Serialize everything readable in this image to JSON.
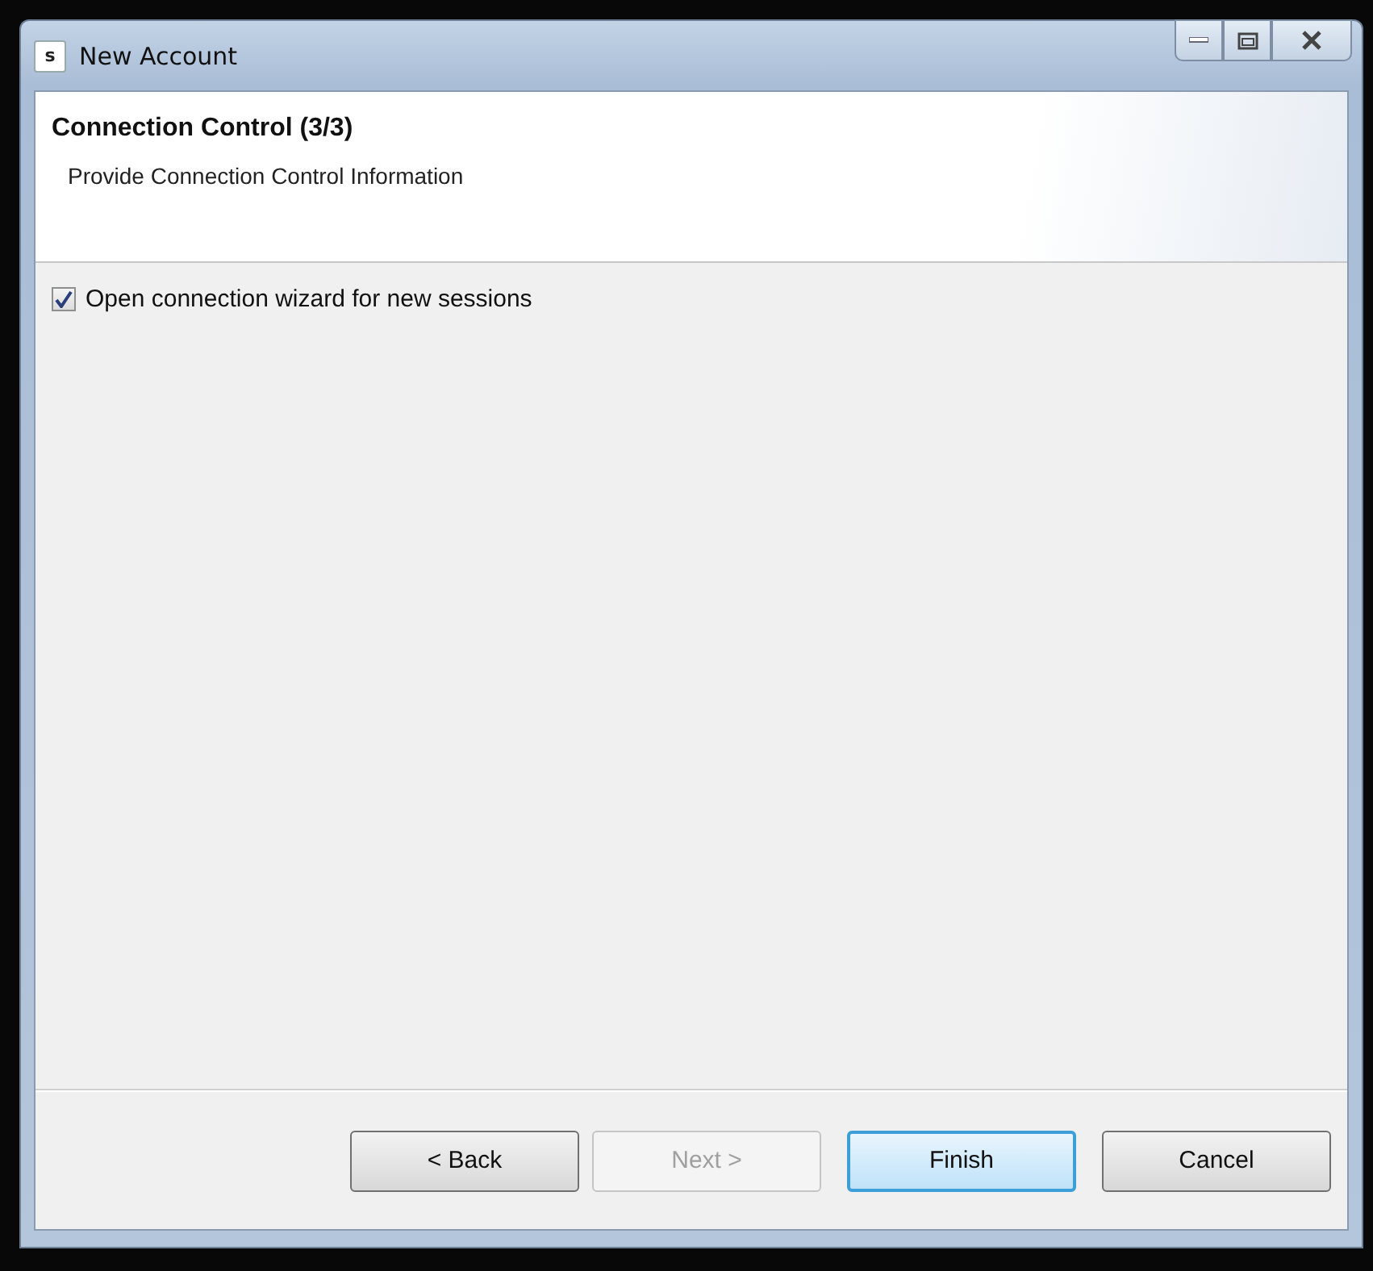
{
  "window": {
    "title": "New Account",
    "icon_letter": "s"
  },
  "header": {
    "title": "Connection Control (3/3)",
    "subtitle": "Provide Connection Control Information"
  },
  "options": [
    {
      "label": "Open connection wizard for new sessions",
      "checked": true
    }
  ],
  "buttons": [
    {
      "label": "< Back",
      "disabled": false,
      "default": false
    },
    {
      "label": "Next >",
      "disabled": true,
      "default": false
    },
    {
      "label": "Finish",
      "disabled": false,
      "default": true
    },
    {
      "label": "Cancel",
      "disabled": false,
      "default": false
    }
  ]
}
